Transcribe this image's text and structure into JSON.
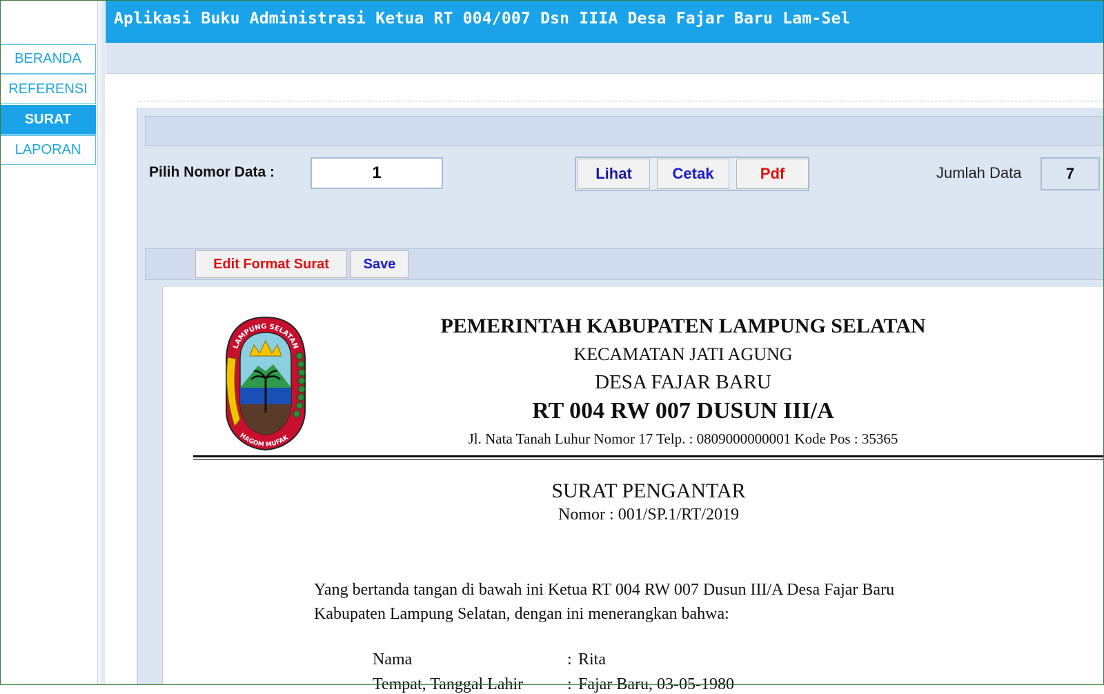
{
  "app": {
    "title": "Aplikasi Buku Administrasi Ketua RT 004/007 Dsn IIIA Desa Fajar Baru Lam-Sel"
  },
  "sidebar": {
    "items": [
      {
        "label": "BERANDA",
        "active": false
      },
      {
        "label": "REFERENSI",
        "active": false
      },
      {
        "label": "SURAT",
        "active": true
      },
      {
        "label": "LAPORAN",
        "active": false
      }
    ]
  },
  "controls": {
    "pilih_label": "Pilih Nomor Data :",
    "nomor_value": "1",
    "lihat_label": "Lihat",
    "cetak_label": "Cetak",
    "pdf_label": "Pdf",
    "jumlah_label": "Jumlah Data",
    "jumlah_value": "7"
  },
  "editbar": {
    "edit_label": "Edit Format Surat",
    "save_label": "Save"
  },
  "document": {
    "logo_text_top": "LAMPUNG SELATAN",
    "logo_text_bottom": "KHAGOM MUFAKAT",
    "kop": {
      "line1": "PEMERINTAH KABUPATEN LAMPUNG SELATAN",
      "line2": "KECAMATAN JATI AGUNG",
      "line3": "DESA FAJAR BARU",
      "line4": "RT 004 RW 007 DUSUN III/A",
      "line5": "Jl. Nata Tanah Luhur Nomor 17 Telp. :  0809000000001 Kode Pos : 35365"
    },
    "title": "SURAT PENGANTAR",
    "nomor": "Nomor : 001/SP.1/RT/2019",
    "para_line1": "Yang bertanda tangan di bawah ini Ketua RT 004 RW 007 Dusun III/A Desa Fajar Baru",
    "para_line2": "Kabupaten Lampung Selatan, dengan ini menerangkan bahwa:",
    "fields": [
      {
        "label": "Nama",
        "value": "Rita"
      },
      {
        "label": "Tempat, Tanggal Lahir",
        "value": "Fajar Baru, 03-05-1980"
      }
    ]
  },
  "colors": {
    "accent": "#1aa3e8",
    "panel": "#dce6f2",
    "lihat": "#1a1aa8",
    "cetak": "#1a1ad0",
    "pdf": "#e01010",
    "edit": "#e01010",
    "save": "#1a1ad0"
  }
}
